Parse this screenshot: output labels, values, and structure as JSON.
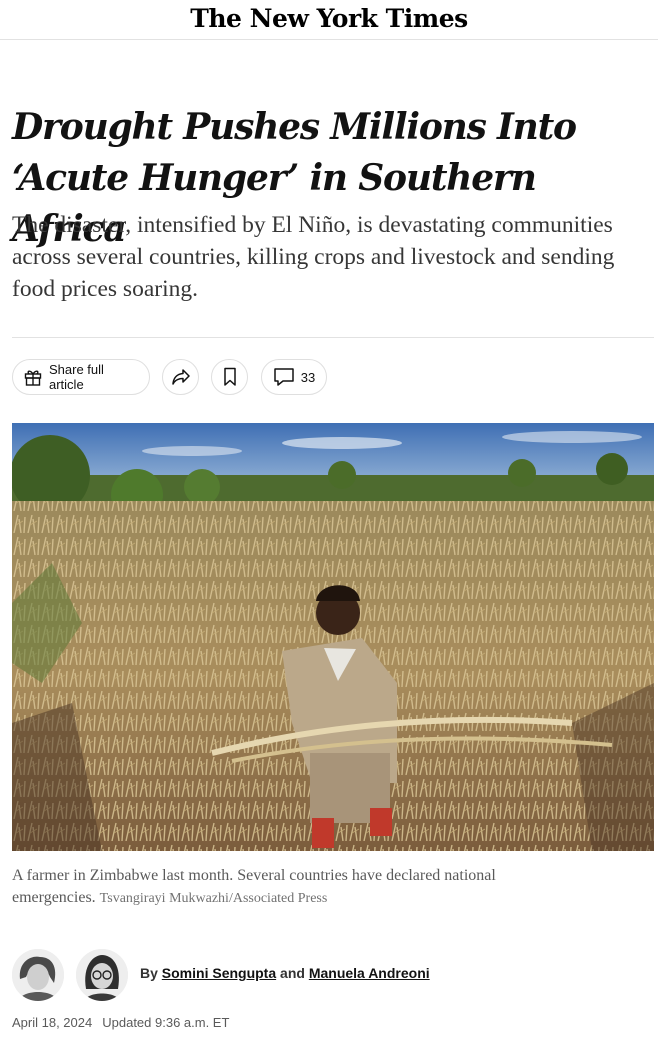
{
  "masthead": {
    "logo_text": "The New York Times"
  },
  "article": {
    "headline": "Drought Pushes Millions Into ‘Acute Hunger’ in Southern Africa",
    "summary": "The disaster, intensified by El Niño, is devastating communities across several countries, killing crops and livestock and sending food prices soaring."
  },
  "actions": {
    "share_full_label": "Share full article",
    "share_icon": "share-arrow-icon",
    "save_icon": "bookmark-icon",
    "comment_icon": "comment-bubble-icon",
    "comments_count": "33"
  },
  "photo": {
    "caption": "A farmer in Zimbabwe last month. Several countries have declared national emergencies.",
    "credit": "Tsvangirayi Mukwazhi/Associated Press"
  },
  "byline": {
    "prefix": "By",
    "author1": "Somini Sengupta",
    "conjunction": "and",
    "author2": "Manuela Andreoni"
  },
  "dates": {
    "published": "April 18, 2024",
    "updated": "Updated 9:36 a.m. ET"
  }
}
